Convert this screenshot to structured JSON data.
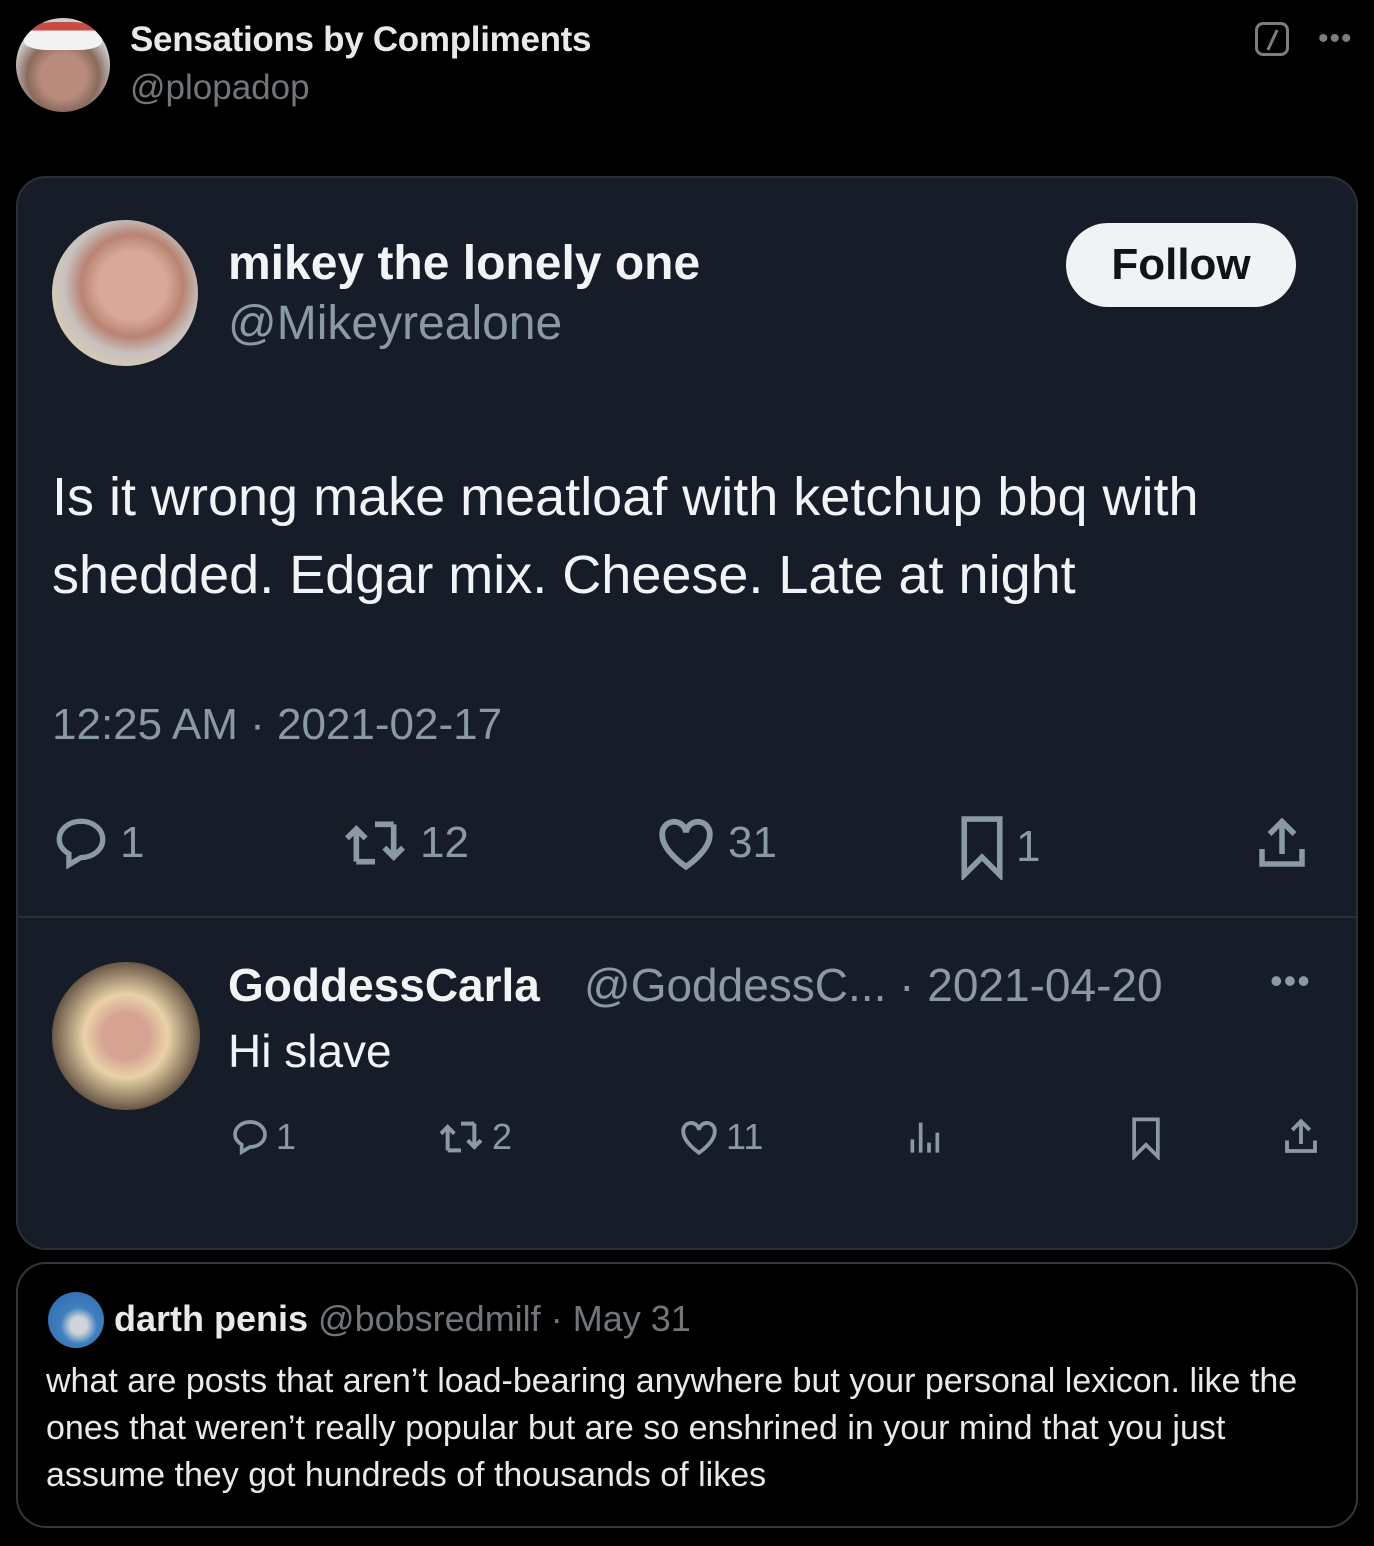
{
  "post": {
    "author_name": "Sensations by Compliments",
    "author_handle": "@plopadop",
    "grok_icon": "grok-slash-icon",
    "more_icon": "more-horizontal-icon",
    "more_glyph": "•••"
  },
  "embedded_screenshot": {
    "original_tweet": {
      "author_name": "mikey the lonely one",
      "author_handle": "@Mikeyrealone",
      "follow_label": "Follow",
      "text": "Is it wrong make meatloaf with ketchup bbq with shedded. Edgar mix. Cheese. Late at night",
      "timestamp": "12:25 AM · 2021-02-17",
      "actions": {
        "replies": "1",
        "retweets": "12",
        "likes": "31",
        "bookmarks": "1"
      }
    },
    "reply": {
      "author_name": "GoddessCarla",
      "meta": "@GoddessC... · 2021-04-20",
      "more_glyph": "•••",
      "text": "Hi slave",
      "actions": {
        "replies": "1",
        "retweets": "2",
        "likes": "11"
      }
    }
  },
  "quoted_post": {
    "author_name": "darth penis",
    "author_handle": "@bobsredmilf",
    "separator": "·",
    "date": "May 31",
    "text": "what are posts that aren’t load-bearing anywhere but your personal lexicon. like the ones that weren’t really popular but are so enshrined  in your mind that you just assume they got hundreds of thousands of likes"
  },
  "colors": {
    "background": "#000000",
    "card_background": "#171d28",
    "muted_text": "#8b98a5",
    "follow_button": "#eff3f4"
  }
}
